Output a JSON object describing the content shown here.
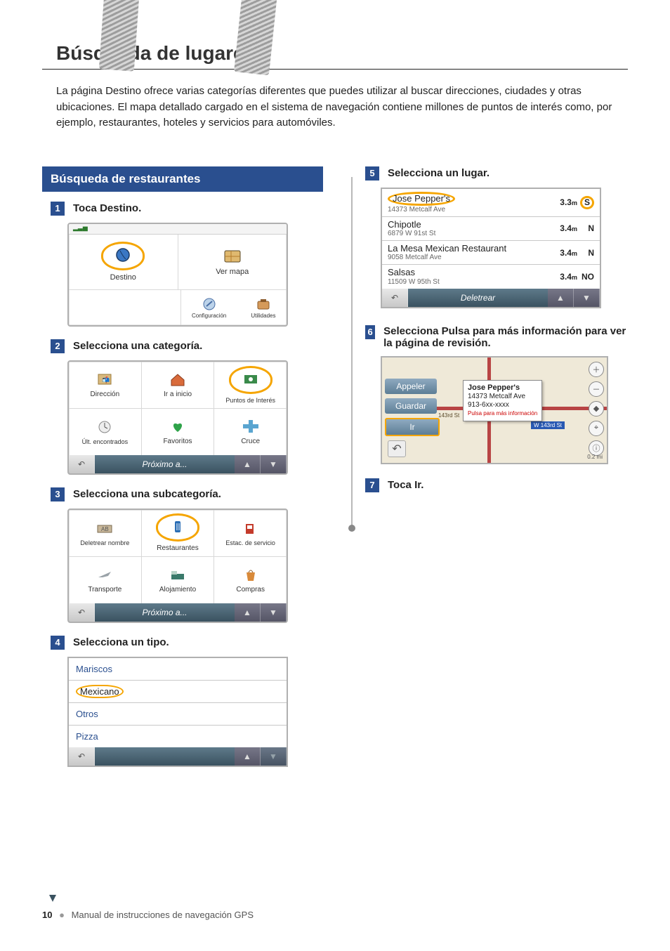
{
  "section_title": "Búsqueda de lugares",
  "intro": "La página Destino ofrece varias categorías diferentes que puedes utilizar al buscar direcciones, ciudades y otras ubicaciones. El mapa detallado cargado en el sistema de navegación contiene millones de puntos de interés como, por ejemplo, restaurantes, hoteles y servicios para automóviles.",
  "left": {
    "section_bar": "Búsqueda de restaurantes",
    "step1": {
      "num": "1",
      "text": "Toca Destino.",
      "screen": {
        "destino": "Destino",
        "vermapa": "Ver mapa",
        "config": "Configuración",
        "utilidades": "Utilidades"
      }
    },
    "step2": {
      "num": "2",
      "text": "Selecciona una categoría.",
      "screen": {
        "direccion": "Dirección",
        "irainicio": "Ir a inicio",
        "poi": "Puntos de Interés",
        "ult": "Últ. encontrados",
        "favoritos": "Favoritos",
        "cruce": "Cruce",
        "proximo": "Próximo a..."
      }
    },
    "step3": {
      "num": "3",
      "text": "Selecciona una subcategoría.",
      "screen": {
        "deletrear": "Deletrear nombre",
        "restaurantes": "Restaurantes",
        "estac": "Estac. de servicio",
        "transporte": "Transporte",
        "alojamiento": "Alojamiento",
        "compras": "Compras",
        "proximo": "Próximo a..."
      }
    },
    "step4": {
      "num": "4",
      "text": "Selecciona un tipo.",
      "types": [
        "Mariscos",
        "Mexicano",
        "Otros",
        "Pizza"
      ],
      "highlight_index": 1
    }
  },
  "right": {
    "step5": {
      "num": "5",
      "text": "Selecciona un lugar.",
      "results": [
        {
          "name": "Jose Pepper's",
          "addr": "14373 Metcalf Ave",
          "dist": "3.3",
          "unit": "m",
          "dir": "S",
          "highlight_name": true,
          "highlight_dir": true
        },
        {
          "name": "Chipotle",
          "addr": "6879 W 91st St",
          "dist": "3.4",
          "unit": "m",
          "dir": "N"
        },
        {
          "name": "La Mesa Mexican Restaurant",
          "addr": "9058 Metcalf Ave",
          "dist": "3.4",
          "unit": "m",
          "dir": "N"
        },
        {
          "name": "Salsas",
          "addr": "11509 W 95th St",
          "dist": "3.4",
          "unit": "m",
          "dir": "NO"
        }
      ],
      "bottombar_center": "Deletrear"
    },
    "step6": {
      "num": "6",
      "text": "Selecciona Pulsa para más información para ver la página de revisión.",
      "map": {
        "btn_appeler": "Appeler",
        "btn_guardar": "Guardar",
        "btn_ir": "Ir",
        "popup_title": "Jose Pepper's",
        "popup_addr": "14373 Metcalf Ave",
        "popup_phone": "913-6xx-xxxx",
        "popup_more": "Pulsa para más información",
        "sign": "W 143rd St",
        "street_label1": "143rd St",
        "scale": "0.2 mi"
      }
    },
    "step7": {
      "num": "7",
      "text": "Toca Ir."
    }
  },
  "footer": {
    "page_num": "10",
    "doc_title": "Manual de instrucciones de navegación GPS"
  }
}
